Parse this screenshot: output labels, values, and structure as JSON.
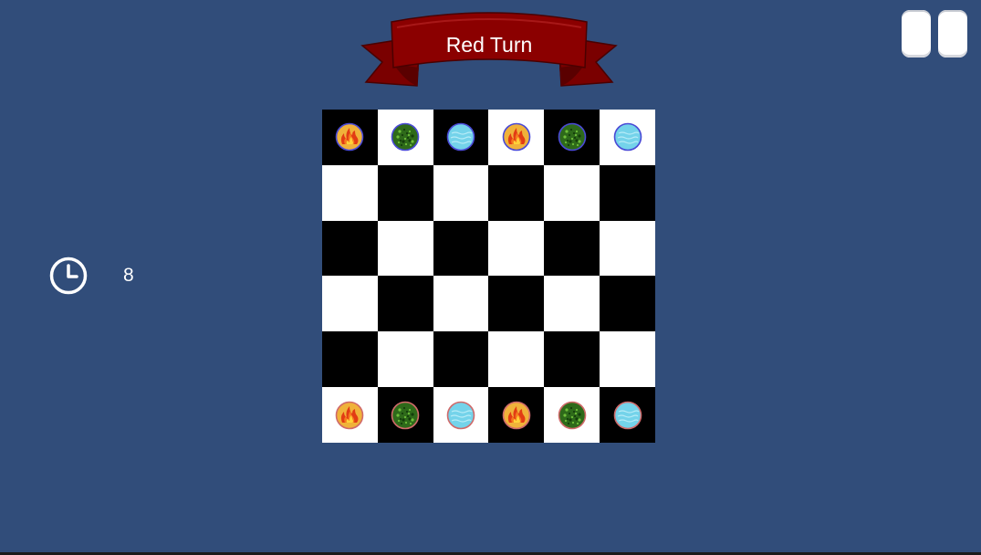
{
  "header": {
    "turn_text": "Red Turn"
  },
  "banner_color": "#8b0000",
  "background_color": "#314d7a",
  "timer": {
    "icon": "clock-icon",
    "value": "8"
  },
  "pause": {
    "icon": "pause-icon"
  },
  "board": {
    "size": 6,
    "top_left_color": "dark",
    "rows": [
      [
        {
          "piece": "fire",
          "team": "blue"
        },
        {
          "piece": "earth",
          "team": "blue"
        },
        {
          "piece": "water",
          "team": "blue"
        },
        {
          "piece": "fire",
          "team": "blue"
        },
        {
          "piece": "earth",
          "team": "blue"
        },
        {
          "piece": "water",
          "team": "blue"
        }
      ],
      [
        null,
        null,
        null,
        null,
        null,
        null
      ],
      [
        null,
        null,
        null,
        null,
        null,
        null
      ],
      [
        null,
        null,
        null,
        null,
        null,
        null
      ],
      [
        null,
        null,
        null,
        null,
        null,
        null
      ],
      [
        {
          "piece": "fire",
          "team": "red"
        },
        {
          "piece": "earth",
          "team": "red"
        },
        {
          "piece": "water",
          "team": "red"
        },
        {
          "piece": "fire",
          "team": "red"
        },
        {
          "piece": "earth",
          "team": "red"
        },
        {
          "piece": "water",
          "team": "red"
        }
      ]
    ]
  }
}
